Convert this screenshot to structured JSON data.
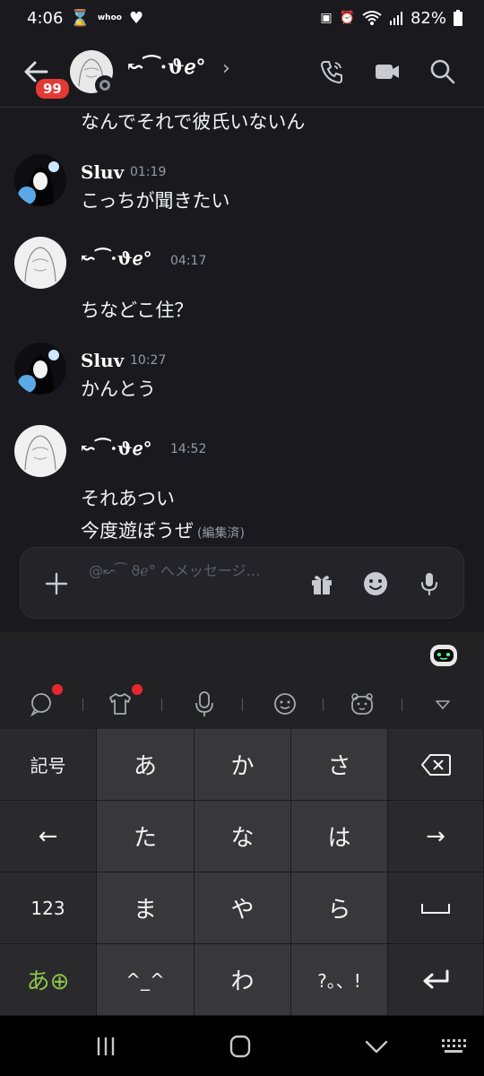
{
  "status_bar": {
    "time": "4:06",
    "mini_label": "whoo",
    "battery": "82%"
  },
  "header": {
    "unread_badge": "99",
    "channel_name": "↜⁀⋅ϑℯ°",
    "chevron": "›"
  },
  "messages": [
    {
      "author": "",
      "time": "",
      "lines": [
        "なんでそれで彼氏いないん"
      ]
    },
    {
      "author": "Sluv",
      "time": "01:19",
      "lines": [
        "こっちが聞きたい"
      ]
    },
    {
      "author": "↜⁀⋅ϑℯ°",
      "time": "04:17",
      "lines": [
        "ちなどこ住？"
      ]
    },
    {
      "author": "Sluv",
      "time": "10:27",
      "lines": [
        "かんとう"
      ]
    },
    {
      "author": "↜⁀⋅ϑℯ°",
      "time": "14:52",
      "lines": [
        "それあつい",
        "今度遊ぼうぜ"
      ],
      "edited": "(編集済)"
    }
  ],
  "input": {
    "placeholder": "@↜⁀ ϑℯ° へメッセージ…"
  },
  "keyboard": {
    "rows": [
      [
        "記号",
        "あ",
        "か",
        "さ",
        "⌫"
      ],
      [
        "←",
        "た",
        "な",
        "は",
        "→"
      ],
      [
        "123",
        "ま",
        "や",
        "ら",
        "␣"
      ],
      [
        "あ⊕",
        "^_^",
        "わ",
        "?。、!",
        "↵"
      ]
    ]
  },
  "colors": {
    "background": "#1a1a1e",
    "badge": "#e53935",
    "keyboard_dark": "#2a2a2d",
    "keyboard_light": "#38383b",
    "globe_key_text": "#8bc34a",
    "red_dot": "#e8262e"
  },
  "icons": {
    "header": [
      "back-arrow-icon",
      "phone-icon",
      "video-icon",
      "search-icon"
    ],
    "input": [
      "plus-icon",
      "gift-icon",
      "emoji-icon",
      "mic-icon"
    ],
    "keyboard_toolbar": [
      "chat-bubble-icon",
      "shirt-icon",
      "voice-icon",
      "smiley-icon",
      "bear-sticker-icon",
      "collapse-icon",
      "robot-icon"
    ],
    "nav": [
      "recents-icon",
      "home-icon",
      "back-icon",
      "keyboard-toggle-icon"
    ]
  }
}
